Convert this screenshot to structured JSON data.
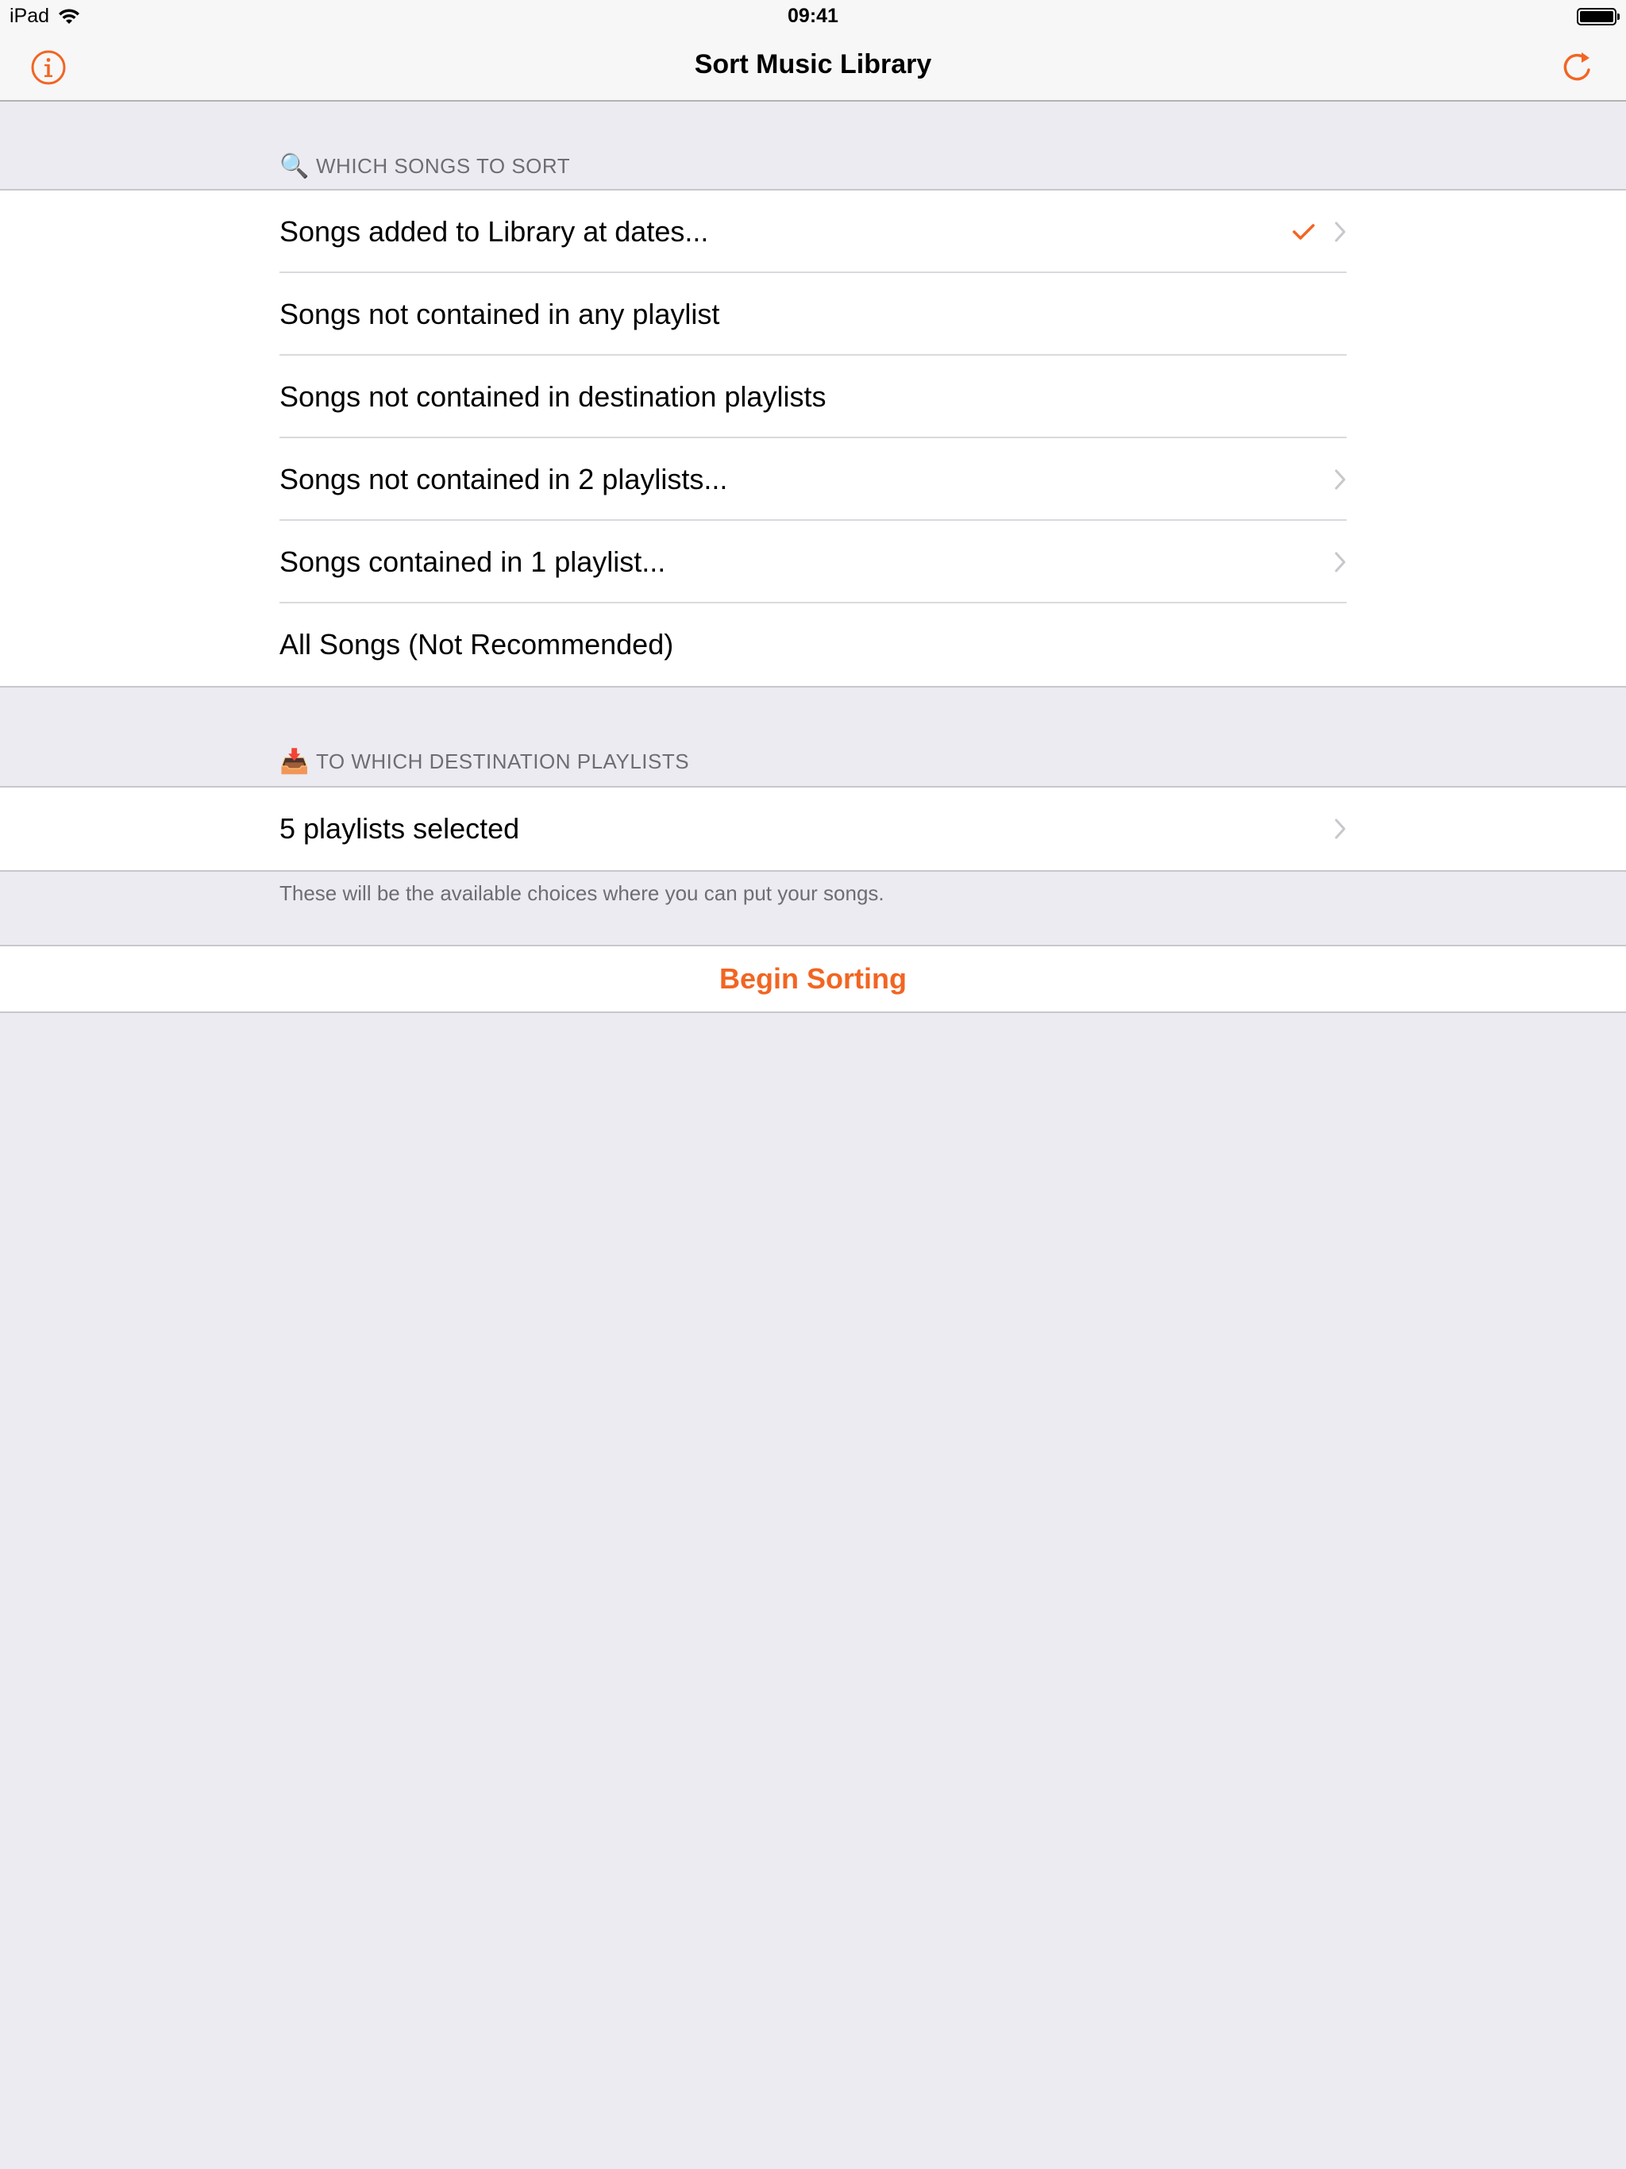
{
  "status": {
    "carrier": "iPad",
    "time": "09:41"
  },
  "nav": {
    "title": "Sort Music Library",
    "left_icon": "info-icon",
    "right_icon": "refresh-icon"
  },
  "accent": "#f26522",
  "which_songs": {
    "emoji": "🔍",
    "header": "WHICH SONGS TO SORT",
    "rows": [
      {
        "label": "Songs added to Library at dates...",
        "checked": true,
        "disclosure": true
      },
      {
        "label": "Songs not contained in any playlist",
        "checked": false,
        "disclosure": false
      },
      {
        "label": "Songs not contained in destination playlists",
        "checked": false,
        "disclosure": false
      },
      {
        "label": "Songs not contained in 2 playlists...",
        "checked": false,
        "disclosure": true
      },
      {
        "label": "Songs contained in 1 playlist...",
        "checked": false,
        "disclosure": true
      },
      {
        "label": "All Songs (Not Recommended)",
        "checked": false,
        "disclosure": false
      }
    ]
  },
  "destination": {
    "emoji": "📥",
    "header": "TO WHICH DESTINATION PLAYLISTS",
    "rows": [
      {
        "label": "5 playlists selected",
        "disclosure": true
      }
    ],
    "footer": "These will be the available choices where you can put your songs."
  },
  "action": {
    "label": "Begin Sorting"
  }
}
